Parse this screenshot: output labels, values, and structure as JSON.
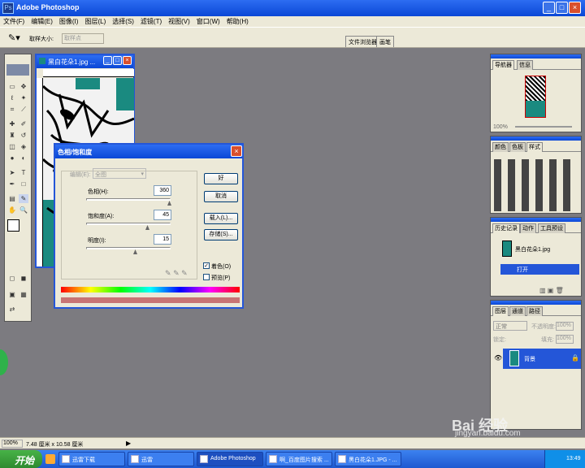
{
  "app": {
    "title": "Adobe Photoshop",
    "icon": "photoshop-icon"
  },
  "menu": [
    "文件(F)",
    "编辑(E)",
    "图像(I)",
    "图层(L)",
    "选择(S)",
    "滤镜(T)",
    "视图(V)",
    "窗口(W)",
    "帮助(H)"
  ],
  "options": {
    "sample_label": "取样大小:",
    "sample_value": "取样点",
    "browser_tab": "文件浏览器",
    "brush_tab": "画笔"
  },
  "document": {
    "title": "黑白花朵1.jpg ..."
  },
  "dialog": {
    "title": "色相/饱和度",
    "edit_label": "编辑(E):",
    "edit_value": "全图",
    "hue_label": "色相(H):",
    "hue_value": "360",
    "saturation_label": "饱和度(A):",
    "saturation_value": "45",
    "lightness_label": "明度(I):",
    "lightness_value": "15",
    "ok": "好",
    "cancel": "取消",
    "load": "载入(L)...",
    "save": "存储(S)...",
    "colorize_label": "着色(O)",
    "preview_label": "预览(P)"
  },
  "colors": {
    "accent": "#2456d8",
    "teal": "#1a8a80"
  },
  "panels": {
    "navigator": {
      "tabs": [
        "导航器",
        "信息"
      ],
      "zoom": "100%"
    },
    "color": {
      "tabs": [
        "颜色",
        "色板",
        "样式"
      ]
    },
    "history": {
      "tabs": [
        "历史记录",
        "动作",
        "工具预设"
      ],
      "snapshot": "黑白花朵1.jpg",
      "step": "打开"
    },
    "layers": {
      "tabs": [
        "图层",
        "通道",
        "路径"
      ],
      "mode": "正常",
      "opacity_label": "不透明度:",
      "opacity": "100%",
      "lock_label": "锁定:",
      "fill_label": "填充:",
      "fill": "100%",
      "layer_name": "背景"
    }
  },
  "status": {
    "zoom": "100%",
    "size": "7.48 厘米 x 10.58 厘米"
  },
  "taskbar": {
    "start": "开始",
    "buttons": [
      "迅雷下载",
      "迅雷",
      "Adobe Photoshop",
      "啊_百度图片搜索 ...",
      "黑白花朵1.JPG - ..."
    ],
    "time": "13:49"
  },
  "watermark": {
    "brand": "Bai 经验",
    "url": "jingyan.baidu.com"
  }
}
